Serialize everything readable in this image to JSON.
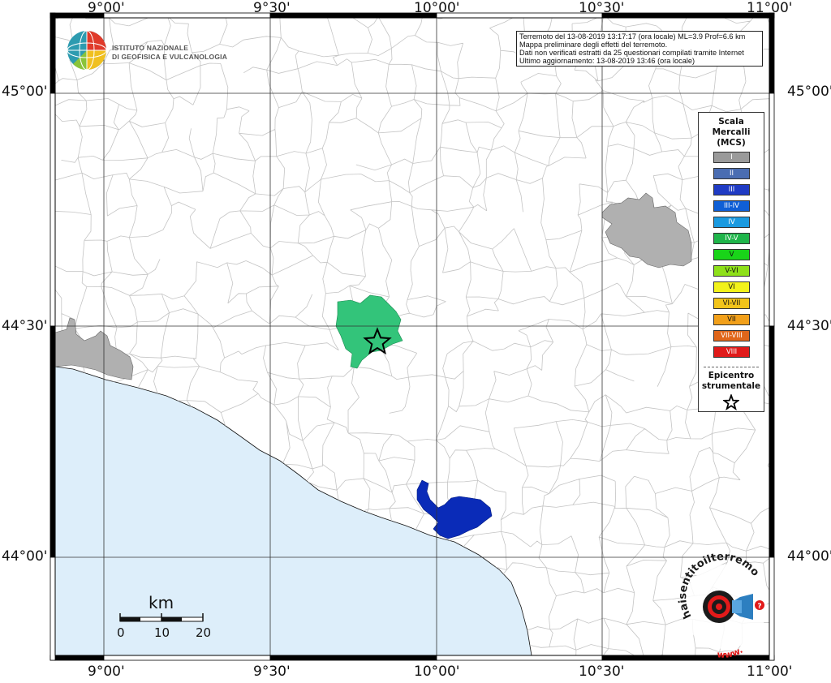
{
  "header": {
    "line1": "Terremoto del 13-08-2019 13:17:17 (ora locale) ML=3.9 Prof=6.6 km",
    "line2": "Mappa preliminare degli effetti del terremoto.",
    "line3": "Dati non verificati estratti da 25 questionari compilati tramite Internet",
    "line4": "Ultimo aggiornamento: 13-08-2019 13:46 (ora locale)"
  },
  "logo": {
    "line1": "ISTITUTO NAZIONALE",
    "line2": "DI GEOFISICA E VULCANOLOGIA",
    "hsit_text": "haisentitoilterremoto.it",
    "hsit_url": "www."
  },
  "axes": {
    "lon_labels": [
      "9°00'",
      "9°30'",
      "10°00'",
      "10°30'",
      "11°00'"
    ],
    "lat_labels": [
      "45°00'",
      "44°30'",
      "44°00'"
    ]
  },
  "legend": {
    "title_lines": [
      "Scala",
      "Mercalli",
      "(MCS)"
    ],
    "items": [
      {
        "label": "I",
        "color": "#9a9a9a"
      },
      {
        "label": "II",
        "color": "#4a6db2"
      },
      {
        "label": "III",
        "color": "#1f3bc4"
      },
      {
        "label": "III-IV",
        "color": "#0f5fd6"
      },
      {
        "label": "IV",
        "color": "#1a9ae0"
      },
      {
        "label": "IV-V",
        "color": "#1fb54a"
      },
      {
        "label": "V",
        "color": "#19d419"
      },
      {
        "label": "V-VI",
        "color": "#8ee01a"
      },
      {
        "label": "VI",
        "color": "#f2f21a"
      },
      {
        "label": "VI-VII",
        "color": "#f2c41a"
      },
      {
        "label": "VII",
        "color": "#f2a01a"
      },
      {
        "label": "VII-VIII",
        "color": "#e0661a"
      },
      {
        "label": "VIII",
        "color": "#e01a1a"
      }
    ],
    "epicenter_lines": [
      "Epicentro",
      "strumentale"
    ]
  },
  "scale_bar": {
    "unit": "km",
    "ticks": [
      "0",
      "10",
      "20"
    ]
  },
  "colors": {
    "sea": "#ddeefa",
    "intensity_II_III": "#0a2bb8",
    "intensity_IV_V": "#33c47a",
    "intensity_I": "#b0b0b0",
    "borders": "#c4c4c4"
  }
}
